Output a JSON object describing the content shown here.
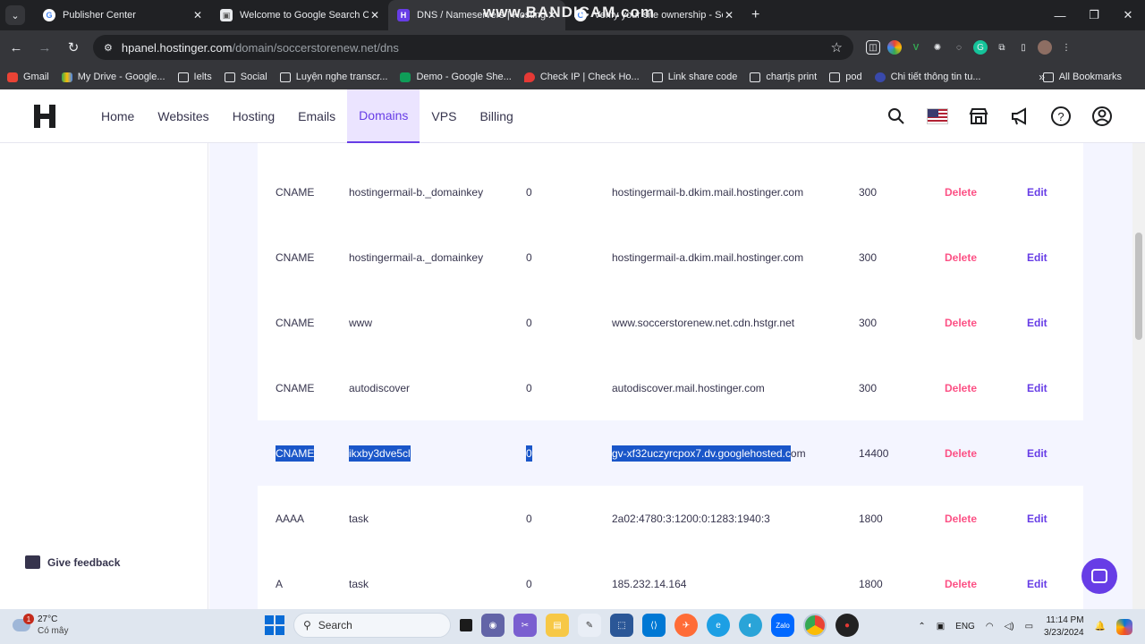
{
  "browser": {
    "tabs": [
      {
        "title": "Publisher Center",
        "favicon": "google-icon",
        "active": false
      },
      {
        "title": "Welcome to Google Search Co",
        "favicon": "search-console-icon",
        "active": false
      },
      {
        "title": "DNS / Nameservers | Hosting",
        "favicon": "hostinger-icon",
        "active": true
      },
      {
        "title": "Verify your site ownership - Sea",
        "favicon": "google-icon",
        "active": false
      }
    ],
    "watermark": "www.BANDICAM.com",
    "url_host": "hpanel.hostinger.com",
    "url_path": "/domain/soccerstorenew.net/dns",
    "bookmarks": [
      {
        "label": "Gmail",
        "icon": "gmail-icon"
      },
      {
        "label": "My Drive - Google...",
        "icon": "drive-icon"
      },
      {
        "label": "Ielts",
        "icon": "folder-icon"
      },
      {
        "label": "Social",
        "icon": "folder-icon"
      },
      {
        "label": "Luyện nghe transcr...",
        "icon": "folder-icon"
      },
      {
        "label": "Demo - Google She...",
        "icon": "sheets-icon"
      },
      {
        "label": "Check IP | Check Ho...",
        "icon": "location-icon"
      },
      {
        "label": "Link share code",
        "icon": "folder-icon"
      },
      {
        "label": "chartjs print",
        "icon": "folder-icon"
      },
      {
        "label": "pod",
        "icon": "folder-icon"
      },
      {
        "label": "Chi tiết thông tin tu...",
        "icon": "globe-icon"
      }
    ],
    "bookmarks_more": "»",
    "all_bookmarks": "All Bookmarks"
  },
  "hostinger": {
    "nav": [
      "Home",
      "Websites",
      "Hosting",
      "Emails",
      "Domains",
      "VPS",
      "Billing"
    ],
    "active_nav": "Domains",
    "feedback": "Give feedback",
    "accent": "#673de6",
    "delete_color": "#fc5185"
  },
  "dns_records": [
    {
      "type": "CNAME",
      "name": "hostingermail-b._domainkey",
      "priority": "0",
      "content": "hostingermail-b.dkim.mail.hostinger.com",
      "ttl": "300",
      "delete": "Delete",
      "edit": "Edit"
    },
    {
      "type": "CNAME",
      "name": "hostingermail-a._domainkey",
      "priority": "0",
      "content": "hostingermail-a.dkim.mail.hostinger.com",
      "ttl": "300",
      "delete": "Delete",
      "edit": "Edit"
    },
    {
      "type": "CNAME",
      "name": "www",
      "priority": "0",
      "content": "www.soccerstorenew.net.cdn.hstgr.net",
      "ttl": "300",
      "delete": "Delete",
      "edit": "Edit"
    },
    {
      "type": "CNAME",
      "name": "autodiscover",
      "priority": "0",
      "content": "autodiscover.mail.hostinger.com",
      "ttl": "300",
      "delete": "Delete",
      "edit": "Edit"
    },
    {
      "type": "CNAME",
      "name": "ikxby3dve5cl",
      "priority": "0",
      "content_selected": "gv-xf32uczyrcpox7.dv.googlehosted.c",
      "content_rest": "om",
      "ttl": "14400",
      "delete": "Delete",
      "edit": "Edit",
      "selected": true
    },
    {
      "type": "AAAA",
      "name": "task",
      "priority": "0",
      "content": "2a02:4780:3:1200:0:1283:1940:3",
      "ttl": "1800",
      "delete": "Delete",
      "edit": "Edit"
    },
    {
      "type": "A",
      "name": "task",
      "priority": "0",
      "content": "185.232.14.164",
      "ttl": "1800",
      "delete": "Delete",
      "edit": "Edit"
    }
  ],
  "taskbar": {
    "weather_temp": "27°C",
    "weather_desc": "Có mây",
    "weather_badge": "1",
    "search": "Search",
    "lang": "ENG",
    "time": "11:14 PM",
    "date": "3/23/2024"
  }
}
